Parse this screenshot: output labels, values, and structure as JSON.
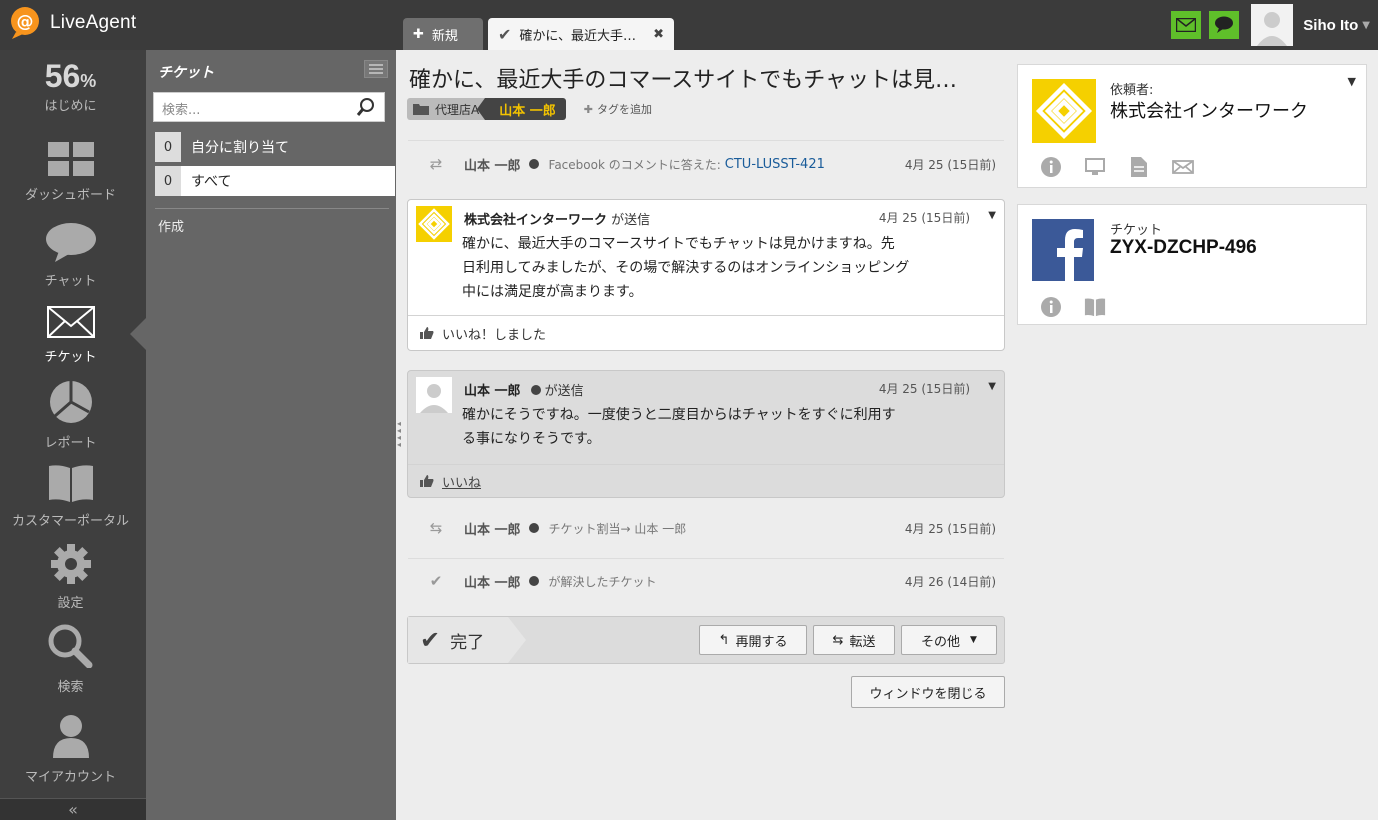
{
  "app": {
    "name": "LiveAgent"
  },
  "tabs": [
    {
      "label": "新規"
    },
    {
      "label": "確かに、最近大手…"
    }
  ],
  "user": {
    "name": "Siho Ito"
  },
  "nav": {
    "progress": {
      "value": "56",
      "unit": "%",
      "label": "はじめに"
    },
    "items": [
      {
        "label": "ダッシュボード"
      },
      {
        "label": "チャット"
      },
      {
        "label": "チケット"
      },
      {
        "label": "レポート"
      },
      {
        "label": "カスタマーポータル"
      },
      {
        "label": "設定"
      },
      {
        "label": "検索"
      },
      {
        "label": "マイアカウント"
      }
    ],
    "collapse": "«"
  },
  "list": {
    "title": "チケット",
    "search_placeholder": "検索...",
    "filters": [
      {
        "count": "0",
        "label": "自分に割り当て"
      },
      {
        "count": "0",
        "label": "すべて"
      }
    ],
    "create": "作成"
  },
  "ticket": {
    "title": "確かに、最近大手のコマースサイトでもチャットは見…",
    "department": "代理店A",
    "agent": "山本 一郎",
    "add_tag": "タグを追加",
    "events": [
      {
        "who": "山本 一郎",
        "text": "Facebook のコメントに答えた:",
        "link": "CTU-LUSST-421",
        "date": "4月 25 (15日前)"
      },
      {
        "who": "山本 一郎",
        "text": "チケット割当→ 山本 一郎",
        "date": "4月 25 (15日前)"
      },
      {
        "who": "山本 一郎",
        "text": "が解決したチケット",
        "date": "4月 26 (14日前)"
      }
    ],
    "messages": [
      {
        "from": "株式会社インターワーク",
        "suffix": "が送信",
        "date": "4月 25 (15日前)",
        "body": [
          "確かに、最近大手のコマースサイトでもチャットは見かけますね。先",
          "日利用してみましたが、その場で解決するのはオンラインショッピング",
          "中には満足度が高まります。"
        ],
        "footer": "いいね！しました"
      },
      {
        "from": "山本 一郎",
        "suffix": "が送信",
        "date": "4月 25 (15日前)",
        "body": [
          "確かにそうですね。一度使うと二度目からはチャットをすぐに利用す",
          "る事になりそうです。"
        ],
        "footer": "いいね"
      }
    ],
    "status": "完了",
    "buttons": {
      "reopen": "再開する",
      "forward": "転送",
      "other": "その他",
      "close_window": "ウィンドウを閉じる"
    }
  },
  "side": {
    "requester": {
      "label": "依頼者:",
      "value": "株式会社インターワーク"
    },
    "ticket": {
      "label": "チケット",
      "value": "ZYX-DZCHP-496"
    }
  },
  "colors": {
    "accent_green": "#5fbf2a",
    "brand_orange": "#f7941d",
    "agent_yellow": "#f2c200",
    "facebook_blue": "#3b5998",
    "link_blue": "#1a5c9a"
  }
}
